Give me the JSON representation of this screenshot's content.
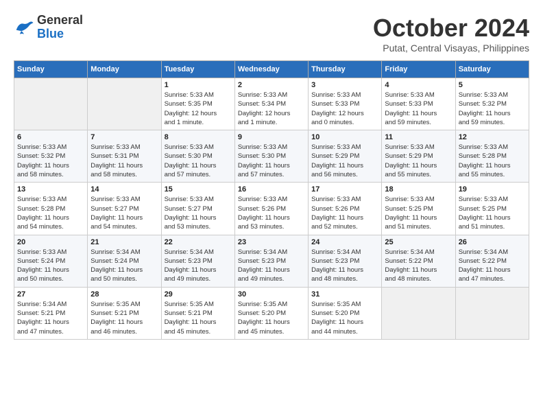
{
  "logo": {
    "general": "General",
    "blue": "Blue"
  },
  "title": "October 2024",
  "location": "Putat, Central Visayas, Philippines",
  "days_header": [
    "Sunday",
    "Monday",
    "Tuesday",
    "Wednesday",
    "Thursday",
    "Friday",
    "Saturday"
  ],
  "weeks": [
    [
      {
        "day": "",
        "info": ""
      },
      {
        "day": "",
        "info": ""
      },
      {
        "day": "1",
        "info": "Sunrise: 5:33 AM\nSunset: 5:35 PM\nDaylight: 12 hours\nand 1 minute."
      },
      {
        "day": "2",
        "info": "Sunrise: 5:33 AM\nSunset: 5:34 PM\nDaylight: 12 hours\nand 1 minute."
      },
      {
        "day": "3",
        "info": "Sunrise: 5:33 AM\nSunset: 5:33 PM\nDaylight: 12 hours\nand 0 minutes."
      },
      {
        "day": "4",
        "info": "Sunrise: 5:33 AM\nSunset: 5:33 PM\nDaylight: 11 hours\nand 59 minutes."
      },
      {
        "day": "5",
        "info": "Sunrise: 5:33 AM\nSunset: 5:32 PM\nDaylight: 11 hours\nand 59 minutes."
      }
    ],
    [
      {
        "day": "6",
        "info": "Sunrise: 5:33 AM\nSunset: 5:32 PM\nDaylight: 11 hours\nand 58 minutes."
      },
      {
        "day": "7",
        "info": "Sunrise: 5:33 AM\nSunset: 5:31 PM\nDaylight: 11 hours\nand 58 minutes."
      },
      {
        "day": "8",
        "info": "Sunrise: 5:33 AM\nSunset: 5:30 PM\nDaylight: 11 hours\nand 57 minutes."
      },
      {
        "day": "9",
        "info": "Sunrise: 5:33 AM\nSunset: 5:30 PM\nDaylight: 11 hours\nand 57 minutes."
      },
      {
        "day": "10",
        "info": "Sunrise: 5:33 AM\nSunset: 5:29 PM\nDaylight: 11 hours\nand 56 minutes."
      },
      {
        "day": "11",
        "info": "Sunrise: 5:33 AM\nSunset: 5:29 PM\nDaylight: 11 hours\nand 55 minutes."
      },
      {
        "day": "12",
        "info": "Sunrise: 5:33 AM\nSunset: 5:28 PM\nDaylight: 11 hours\nand 55 minutes."
      }
    ],
    [
      {
        "day": "13",
        "info": "Sunrise: 5:33 AM\nSunset: 5:28 PM\nDaylight: 11 hours\nand 54 minutes."
      },
      {
        "day": "14",
        "info": "Sunrise: 5:33 AM\nSunset: 5:27 PM\nDaylight: 11 hours\nand 54 minutes."
      },
      {
        "day": "15",
        "info": "Sunrise: 5:33 AM\nSunset: 5:27 PM\nDaylight: 11 hours\nand 53 minutes."
      },
      {
        "day": "16",
        "info": "Sunrise: 5:33 AM\nSunset: 5:26 PM\nDaylight: 11 hours\nand 53 minutes."
      },
      {
        "day": "17",
        "info": "Sunrise: 5:33 AM\nSunset: 5:26 PM\nDaylight: 11 hours\nand 52 minutes."
      },
      {
        "day": "18",
        "info": "Sunrise: 5:33 AM\nSunset: 5:25 PM\nDaylight: 11 hours\nand 51 minutes."
      },
      {
        "day": "19",
        "info": "Sunrise: 5:33 AM\nSunset: 5:25 PM\nDaylight: 11 hours\nand 51 minutes."
      }
    ],
    [
      {
        "day": "20",
        "info": "Sunrise: 5:33 AM\nSunset: 5:24 PM\nDaylight: 11 hours\nand 50 minutes."
      },
      {
        "day": "21",
        "info": "Sunrise: 5:34 AM\nSunset: 5:24 PM\nDaylight: 11 hours\nand 50 minutes."
      },
      {
        "day": "22",
        "info": "Sunrise: 5:34 AM\nSunset: 5:23 PM\nDaylight: 11 hours\nand 49 minutes."
      },
      {
        "day": "23",
        "info": "Sunrise: 5:34 AM\nSunset: 5:23 PM\nDaylight: 11 hours\nand 49 minutes."
      },
      {
        "day": "24",
        "info": "Sunrise: 5:34 AM\nSunset: 5:23 PM\nDaylight: 11 hours\nand 48 minutes."
      },
      {
        "day": "25",
        "info": "Sunrise: 5:34 AM\nSunset: 5:22 PM\nDaylight: 11 hours\nand 48 minutes."
      },
      {
        "day": "26",
        "info": "Sunrise: 5:34 AM\nSunset: 5:22 PM\nDaylight: 11 hours\nand 47 minutes."
      }
    ],
    [
      {
        "day": "27",
        "info": "Sunrise: 5:34 AM\nSunset: 5:21 PM\nDaylight: 11 hours\nand 47 minutes."
      },
      {
        "day": "28",
        "info": "Sunrise: 5:35 AM\nSunset: 5:21 PM\nDaylight: 11 hours\nand 46 minutes."
      },
      {
        "day": "29",
        "info": "Sunrise: 5:35 AM\nSunset: 5:21 PM\nDaylight: 11 hours\nand 45 minutes."
      },
      {
        "day": "30",
        "info": "Sunrise: 5:35 AM\nSunset: 5:20 PM\nDaylight: 11 hours\nand 45 minutes."
      },
      {
        "day": "31",
        "info": "Sunrise: 5:35 AM\nSunset: 5:20 PM\nDaylight: 11 hours\nand 44 minutes."
      },
      {
        "day": "",
        "info": ""
      },
      {
        "day": "",
        "info": ""
      }
    ]
  ]
}
